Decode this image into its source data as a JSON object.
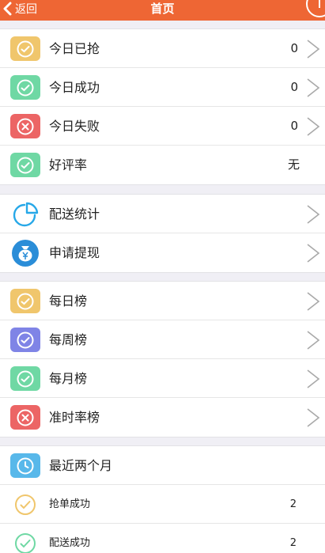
{
  "navbar": {
    "back_label": "返回",
    "title": "首页"
  },
  "stats": [
    {
      "label": "今日已抢",
      "value": "0",
      "color": "#f0c66c",
      "icon": "check-circle-icon"
    },
    {
      "label": "今日成功",
      "value": "0",
      "color": "#6fd8a4",
      "icon": "check-circle-icon"
    },
    {
      "label": "今日失败",
      "value": "0",
      "color": "#ec6565",
      "icon": "x-circle-icon"
    },
    {
      "label": "好评率",
      "value": "无",
      "color": "#6fd8a4",
      "icon": "check-circle-icon"
    }
  ],
  "services": [
    {
      "label": "配送统计",
      "icon": "pie-chart-icon",
      "color": "#27a8e8"
    },
    {
      "label": "申请提现",
      "icon": "money-bag-icon",
      "color": "#2a8dd8"
    }
  ],
  "rankings": [
    {
      "label": "每日榜",
      "color": "#f0c66c",
      "icon": "check-circle-icon"
    },
    {
      "label": "每周榜",
      "color": "#7f84e6",
      "icon": "check-circle-icon"
    },
    {
      "label": "每月榜",
      "color": "#6fd8a4",
      "icon": "check-circle-icon"
    },
    {
      "label": "准时率榜",
      "color": "#ec6565",
      "icon": "x-circle-icon"
    }
  ],
  "recent": {
    "header": {
      "label": "最近两个月",
      "color": "#58b8ea",
      "icon": "clock-icon"
    },
    "items": [
      {
        "label": "抢单成功",
        "value": "2",
        "color": "#f0c66c",
        "icon": "check-circle-icon"
      },
      {
        "label": "配送成功",
        "value": "2",
        "color": "#6fd8a4",
        "icon": "check-circle-icon"
      }
    ]
  },
  "colors": {
    "navbar": "#ee6634",
    "background": "#f0eff5",
    "chevron": "#a9a9a9"
  }
}
